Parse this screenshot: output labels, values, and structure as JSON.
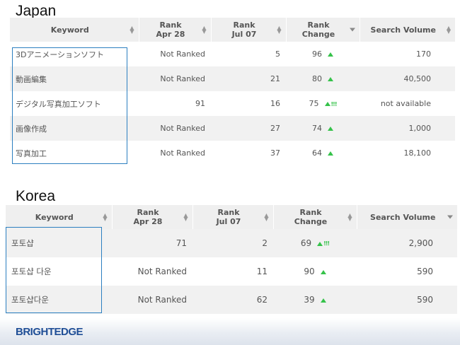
{
  "japan": {
    "title": "Japan",
    "headers": {
      "keyword": "Keyword",
      "rank_apr_1": "Rank",
      "rank_apr_2": "Apr 28",
      "rank_jul_1": "Rank",
      "rank_jul_2": "Jul 07",
      "change_1": "Rank",
      "change_2": "Change",
      "volume": "Search Volume"
    },
    "rows": [
      {
        "keyword": "3Dアニメーションソフト",
        "apr28": "Not Ranked",
        "jul07": "5",
        "change": "96",
        "alert": "",
        "volume": "170"
      },
      {
        "keyword": "動画編集",
        "apr28": "Not Ranked",
        "jul07": "21",
        "change": "80",
        "alert": "",
        "volume": "40,500"
      },
      {
        "keyword": "デジタル写真加工ソフト",
        "apr28": "91",
        "jul07": "16",
        "change": "75",
        "alert": "!!!",
        "volume": "not available"
      },
      {
        "keyword": "画像作成",
        "apr28": "Not Ranked",
        "jul07": "27",
        "change": "74",
        "alert": "",
        "volume": "1,000"
      },
      {
        "keyword": "写真加工",
        "apr28": "Not Ranked",
        "jul07": "37",
        "change": "64",
        "alert": "",
        "volume": "18,100"
      }
    ]
  },
  "korea": {
    "title": "Korea",
    "headers": {
      "keyword": "Keyword",
      "rank_apr_1": "Rank",
      "rank_apr_2": "Apr 28",
      "rank_jul_1": "Rank",
      "rank_jul_2": "Jul 07",
      "change_1": "Rank",
      "change_2": "Change",
      "volume": "Search Volume"
    },
    "rows": [
      {
        "keyword": "포토샵",
        "apr28": "71",
        "jul07": "2",
        "change": "69",
        "alert": "!!!",
        "volume": "2,900"
      },
      {
        "keyword": "포토샵 다운",
        "apr28": "Not Ranked",
        "jul07": "11",
        "change": "90",
        "alert": "",
        "volume": "590"
      },
      {
        "keyword": "포토샵다운",
        "apr28": "Not Ranked",
        "jul07": "62",
        "change": "39",
        "alert": "",
        "volume": "590"
      }
    ]
  },
  "brand": {
    "logo_text": "BRIGHTEDGE"
  },
  "colors": {
    "link": "#2f8fd2",
    "up_arrow": "#35c24a",
    "highlight_border": "#2c7fc0",
    "brand": "#1f4e96"
  },
  "icons": {
    "sort": "sort-icon",
    "sorted_desc": "chevron-down-icon",
    "rank_up": "triangle-up-icon",
    "alert": "alert-icon"
  }
}
